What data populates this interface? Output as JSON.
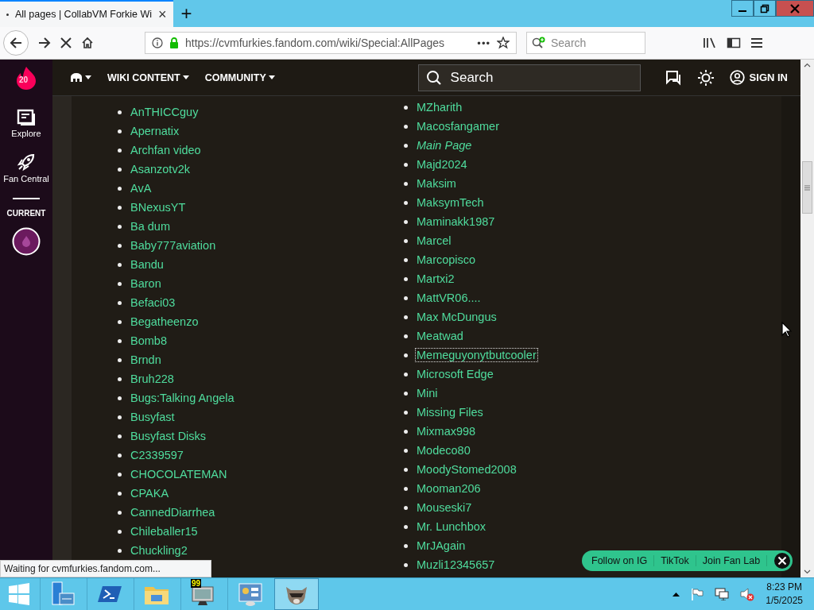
{
  "browser": {
    "tab": {
      "title": "All pages | CollabVM Forkie Wi",
      "close": "×"
    },
    "new_tab": "+",
    "loading": true,
    "url": "https://cvmfurkies.fandom.com/wiki/Special:AllPages",
    "page_actions": "•••",
    "search": {
      "placeholder": "Search"
    }
  },
  "wiki_header": {
    "logo_badge": "20",
    "nav": [
      {
        "label": "WIKI CONTENT"
      },
      {
        "label": "COMMUNITY"
      }
    ],
    "search": {
      "placeholder": "Search"
    },
    "sign_in": "SIGN IN"
  },
  "rail": {
    "items": [
      {
        "label": "Explore",
        "kind": "explore"
      },
      {
        "label": "Fan Central",
        "kind": "fan"
      }
    ],
    "current_label": "CURRENT"
  },
  "pages": {
    "column_1": [
      {
        "title": "AnTHICCguy"
      },
      {
        "title": "Apernatix"
      },
      {
        "title": "Archfan video"
      },
      {
        "title": "Asanzotv2k"
      },
      {
        "title": "AvA"
      },
      {
        "title": "BNexusYT"
      },
      {
        "title": "Ba dum"
      },
      {
        "title": "Baby777aviation"
      },
      {
        "title": "Bandu"
      },
      {
        "title": "Baron"
      },
      {
        "title": "Befaci03"
      },
      {
        "title": "Begatheenzo"
      },
      {
        "title": "Bomb8"
      },
      {
        "title": "Brndn"
      },
      {
        "title": "Bruh228"
      },
      {
        "title": "Bugs:Talking Angela"
      },
      {
        "title": "Busyfast"
      },
      {
        "title": "Busyfast Disks"
      },
      {
        "title": "C2339597"
      },
      {
        "title": "CHOCOLATEMAN"
      },
      {
        "title": "CPAKA"
      },
      {
        "title": "CannedDiarrhea"
      },
      {
        "title": "Chileballer15"
      },
      {
        "title": "Chuckling2"
      }
    ],
    "column_2": [
      {
        "title": "MZharith",
        "italic": false,
        "focused": false
      },
      {
        "title": "Macosfangamer",
        "italic": false,
        "focused": false
      },
      {
        "title": "Main Page",
        "italic": true,
        "focused": false
      },
      {
        "title": "Majd2024",
        "italic": false,
        "focused": false
      },
      {
        "title": "Maksim",
        "italic": false,
        "focused": false
      },
      {
        "title": "MaksymTech",
        "italic": false,
        "focused": false
      },
      {
        "title": "Maminakk1987",
        "italic": false,
        "focused": false
      },
      {
        "title": "Marcel",
        "italic": false,
        "focused": false
      },
      {
        "title": "Marcopisco",
        "italic": false,
        "focused": false
      },
      {
        "title": "Martxi2",
        "italic": false,
        "focused": false
      },
      {
        "title": "MattVR06....",
        "italic": false,
        "focused": false
      },
      {
        "title": "Max McDungus",
        "italic": false,
        "focused": false
      },
      {
        "title": "Meatwad",
        "italic": false,
        "focused": false
      },
      {
        "title": "Memeguyonytbutcooler",
        "italic": false,
        "focused": true
      },
      {
        "title": "Microsoft Edge",
        "italic": false,
        "focused": false
      },
      {
        "title": "Mini",
        "italic": false,
        "focused": false
      },
      {
        "title": "Missing Files",
        "italic": false,
        "focused": false
      },
      {
        "title": "Mixmax998",
        "italic": false,
        "focused": false
      },
      {
        "title": "Modeco80",
        "italic": false,
        "focused": false
      },
      {
        "title": "MoodyStomed2008",
        "italic": false,
        "focused": false
      },
      {
        "title": "Mooman206",
        "italic": false,
        "focused": false
      },
      {
        "title": "Mouseski7",
        "italic": false,
        "focused": false
      },
      {
        "title": "Mr. Lunchbox",
        "italic": false,
        "focused": false
      },
      {
        "title": "MrJAgain",
        "italic": false,
        "focused": false
      },
      {
        "title": "Muzli12345657",
        "italic": false,
        "focused": false
      }
    ]
  },
  "status_text": "Waiting for cvmfurkies.fandom.com...",
  "promo": {
    "buttons": [
      "Follow on IG",
      "TikTok",
      "Join Fan Lab"
    ]
  },
  "taskbar": {
    "apps": [
      {
        "kind": "server",
        "active": false
      },
      {
        "kind": "powershell",
        "active": false
      },
      {
        "kind": "folder",
        "active": false
      },
      {
        "kind": "monitor",
        "active": false,
        "badge": "99"
      },
      {
        "kind": "control-panel",
        "active": false
      },
      {
        "kind": "raccoon",
        "active": true
      }
    ],
    "time": "8:23 PM",
    "date": "1/5/2025"
  }
}
